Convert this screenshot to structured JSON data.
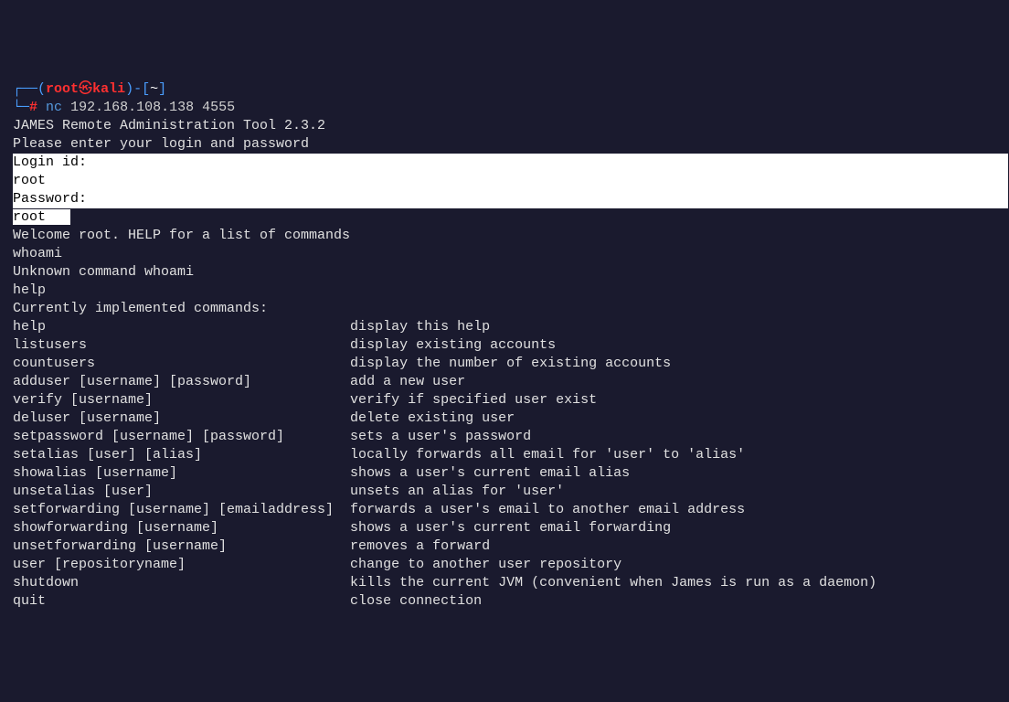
{
  "prompt": {
    "box_top": "┌──",
    "box_bottom": "└─",
    "open_paren": "(",
    "user": "root",
    "at": "㉿",
    "host": "kali",
    "close_paren": ")",
    "dash": "-",
    "open_bracket": "[",
    "tilde": "~",
    "close_bracket": "]",
    "hash": "#",
    "command": "nc",
    "args": "192.168.108.138 4555"
  },
  "output": {
    "banner1": "JAMES Remote Administration Tool 2.3.2",
    "banner2": "Please enter your login and password",
    "login_prompt": "Login id:",
    "login_value": "root",
    "password_prompt": "Password:",
    "password_value": "root",
    "welcome": "Welcome root. HELP for a list of commands",
    "cmd1": "whoami",
    "resp1": "Unknown command whoami",
    "cmd2": "help",
    "help_header": "Currently implemented commands:"
  },
  "help": [
    {
      "cmd": "help",
      "desc": "display this help"
    },
    {
      "cmd": "listusers",
      "desc": "display existing accounts"
    },
    {
      "cmd": "countusers",
      "desc": "display the number of existing accounts"
    },
    {
      "cmd": "adduser [username] [password]",
      "desc": "add a new user"
    },
    {
      "cmd": "verify [username]",
      "desc": "verify if specified user exist"
    },
    {
      "cmd": "deluser [username]",
      "desc": "delete existing user"
    },
    {
      "cmd": "setpassword [username] [password]",
      "desc": "sets a user's password"
    },
    {
      "cmd": "setalias [user] [alias]",
      "desc": "locally forwards all email for 'user' to 'alias'"
    },
    {
      "cmd": "showalias [username]",
      "desc": "shows a user's current email alias"
    },
    {
      "cmd": "unsetalias [user]",
      "desc": "unsets an alias for 'user'"
    },
    {
      "cmd": "setforwarding [username] [emailaddress]",
      "desc": "forwards a user's email to another email address"
    },
    {
      "cmd": "showforwarding [username]",
      "desc": "shows a user's current email forwarding"
    },
    {
      "cmd": "unsetforwarding [username]",
      "desc": "removes a forward"
    },
    {
      "cmd": "user [repositoryname]",
      "desc": "change to another user repository"
    },
    {
      "cmd": "shutdown",
      "desc": "kills the current JVM (convenient when James is run as a daemon)"
    },
    {
      "cmd": "quit",
      "desc": "close connection"
    }
  ]
}
